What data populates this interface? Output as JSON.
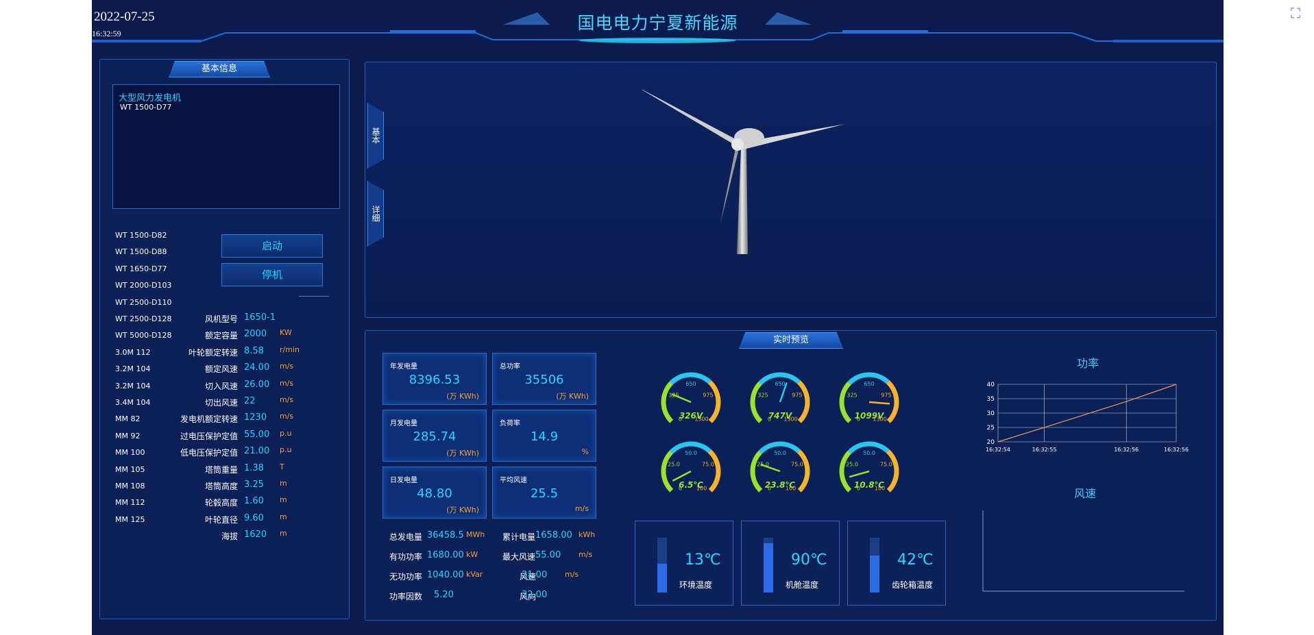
{
  "window_button": "fullscreen-icon",
  "header": {
    "date": "2022-07-25",
    "time": "16:32:59",
    "title": "国电电力宁夏新能源"
  },
  "left_panel": {
    "title": "基本信息",
    "info_name": "大型风力发电机",
    "info_model": "WT 1500-D77",
    "start_label": "启动",
    "stop_label": "停机",
    "models": [
      "WT 1500-D82",
      "WT 1500-D88",
      "WT 1650-D77",
      "WT 2000-D103",
      "WT 2500-D110",
      "WT 2500-D128",
      "WT 5000-D128",
      "3.0M  112",
      "3.2M  104",
      "3.2M  104",
      "3.4M  104",
      "MM  82",
      "MM  92",
      "MM  100",
      "MM  105",
      "MM  108",
      "MM  112",
      "MM  125"
    ],
    "params": [
      {
        "label": "风机型号",
        "value": "1650-1",
        "unit": ""
      },
      {
        "label": "额定容量",
        "value": "2000",
        "unit": "KW"
      },
      {
        "label": "叶轮额定转速",
        "value": "8.58",
        "unit": "r/min"
      },
      {
        "label": "额定风速",
        "value": "24.00",
        "unit": "m/s"
      },
      {
        "label": "切入风速",
        "value": "26.00",
        "unit": "m/s"
      },
      {
        "label": "切出风速",
        "value": "22",
        "unit": "m/s"
      },
      {
        "label": "发电机额定转速",
        "value": "1230",
        "unit": "m/s"
      },
      {
        "label": "过电压保护定值",
        "value": "55.00",
        "unit": "p.u"
      },
      {
        "label": "低电压保护定值",
        "value": "21.00",
        "unit": "p.u"
      },
      {
        "label": "塔筒重量",
        "value": "1.38",
        "unit": "T"
      },
      {
        "label": "塔筒高度",
        "value": "3.25",
        "unit": "m"
      },
      {
        "label": "轮毂高度",
        "value": "1.60",
        "unit": "m"
      },
      {
        "label": "叶轮直径",
        "value": "9.60",
        "unit": "m"
      },
      {
        "label": "海拔",
        "value": "1620",
        "unit": "m"
      }
    ]
  },
  "view_tabs": [
    "基本",
    "详细"
  ],
  "realtime": {
    "title": "实时预览",
    "cards": [
      {
        "title": "年发电量",
        "value": "8396.53",
        "unit": "(万 KWh)"
      },
      {
        "title": "总功率",
        "value": "35506",
        "unit": "(万 KWh)"
      },
      {
        "title": "月发电量",
        "value": "285.74",
        "unit": "(万 KWh)"
      },
      {
        "title": "负荷率",
        "value": "14.9",
        "unit": "%"
      },
      {
        "title": "日发电量",
        "value": "48.80",
        "unit": "(万 KWh)"
      },
      {
        "title": "平均风速",
        "value": "25.5",
        "unit": "m/s"
      }
    ],
    "stats_left": [
      {
        "label": "总发电量",
        "value": "36458.5",
        "unit": "MWh"
      },
      {
        "label": "有功功率",
        "value": "1680.00",
        "unit": "kW"
      },
      {
        "label": "无功功率",
        "value": "1040.00",
        "unit": "kVar"
      },
      {
        "label": "功率因数",
        "value": "5.20",
        "unit": ""
      }
    ],
    "stats_right": [
      {
        "label": "累计电量",
        "value": "1658.00",
        "unit": "kWh"
      },
      {
        "label": "最大风速",
        "value": "55.00",
        "unit": "m/s"
      },
      {
        "label": "风速",
        "value": "21.00",
        "unit": "m/s"
      },
      {
        "label": "风向",
        "value": "32.00",
        "unit": ""
      }
    ],
    "gauges_voltage": [
      {
        "value": "326V",
        "ticks": [
          "0",
          "325",
          "650",
          "975",
          "1300"
        ],
        "fraction": 0.25
      },
      {
        "value": "747V",
        "ticks": [
          "0",
          "325",
          "650",
          "975",
          "1300"
        ],
        "fraction": 0.57
      },
      {
        "value": "1099V",
        "ticks": [
          "0",
          "325",
          "650",
          "975",
          "1300"
        ],
        "fraction": 0.85
      }
    ],
    "gauges_temp": [
      {
        "value": "6.5℃",
        "ticks": [
          "0",
          "25.0",
          "50.0",
          "75.0",
          "100"
        ],
        "fraction": 0.065
      },
      {
        "value": "23.8℃",
        "ticks": [
          "0",
          "25.0",
          "50.0",
          "75.0",
          "100"
        ],
        "fraction": 0.238
      },
      {
        "value": "10.8℃",
        "ticks": [
          "0",
          "25.0",
          "50.0",
          "75.0",
          "100"
        ],
        "fraction": 0.108
      }
    ],
    "temps": [
      {
        "value": "13℃",
        "label": "环境温度",
        "level": 0.52
      },
      {
        "value": "90℃",
        "label": "机舱温度",
        "level": 0.9
      },
      {
        "value": "42℃",
        "label": "齿轮箱温度",
        "level": 0.68
      }
    ]
  },
  "colors": {
    "accent": "#2ad6ff",
    "unit": "#f7a13a",
    "panel": "#0c2058",
    "border": "#1f5fc0"
  },
  "chart_data": [
    {
      "type": "line",
      "title": "功率",
      "x": [
        "16:32:54",
        "16:32:55",
        "16:32:56",
        "16:32:56"
      ],
      "ylim": [
        20,
        40
      ],
      "yticks": [
        "40",
        "35",
        "30",
        "25",
        "20"
      ],
      "series": [
        {
          "values": [
            20,
            25,
            34,
            40
          ]
        }
      ]
    },
    {
      "type": "line",
      "title": "风速",
      "x": [],
      "series": []
    }
  ]
}
